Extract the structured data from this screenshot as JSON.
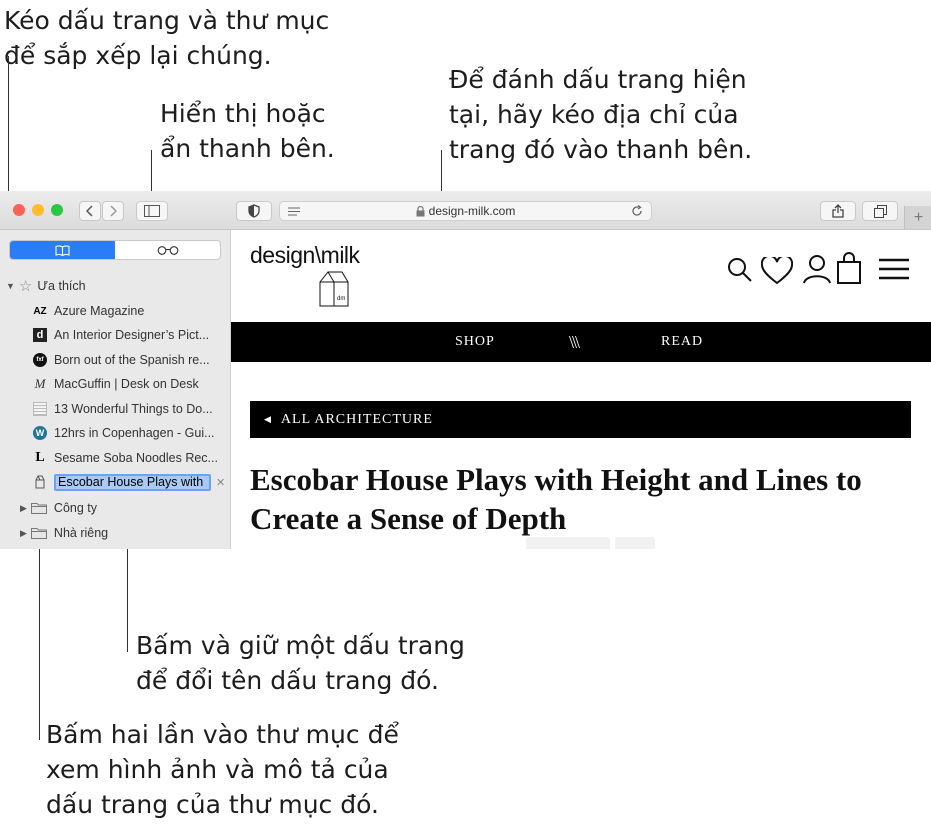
{
  "callouts": {
    "reorder": "Kéo dấu trang và thư mục\nđể sắp xếp lại chúng.",
    "toggle_sidebar": "Hiển thị hoặc\nẩn thanh bên.",
    "bookmark_page": "Để đánh dấu trang hiện\ntại, hãy kéo địa chỉ của\ntrang đó vào thanh bên.",
    "rename": "Bấm và giữ một dấu trang\nđể đổi tên dấu trang đó.",
    "folder": "Bấm hai lần vào thư mục để\nxem hình ảnh và mô tả của\ndấu trang của thư mục đó."
  },
  "toolbar": {
    "address": "design-milk.com",
    "new_tab": "+"
  },
  "sidebar": {
    "favorites_label": "Ưa thích",
    "bookmarks": [
      {
        "icon": "azure-favicon",
        "glyph": "AZ",
        "label": "Azure Magazine"
      },
      {
        "icon": "dwell-favicon",
        "glyph": "d",
        "label": "An Interior Designer’s Pict..."
      },
      {
        "icon": "fxf-favicon",
        "glyph": "fxf",
        "label": "Born out of the Spanish re..."
      },
      {
        "icon": "macguffin-favicon",
        "glyph": "M",
        "label": "MacGuffin | Desk on Desk"
      },
      {
        "icon": "grid-favicon",
        "glyph": "",
        "label": "13 Wonderful Things to Do..."
      },
      {
        "icon": "wordpress-favicon",
        "glyph": "W",
        "label": "12hrs in Copenhagen - Gui..."
      },
      {
        "icon": "l-favicon",
        "glyph": "L",
        "label": "Sesame Soba Noodles Rec..."
      }
    ],
    "editing_value": "Escobar House Plays with H",
    "folders": [
      "Công ty",
      "Nhà riêng"
    ]
  },
  "site": {
    "logo": "design\\milk",
    "carton_label": "dm",
    "nav": [
      "SHOP",
      "\\\\\\",
      "READ"
    ],
    "category": "ALL ARCHITECTURE",
    "headline": "Escobar House Plays with Height and Lines to Create a Sense of Depth"
  }
}
